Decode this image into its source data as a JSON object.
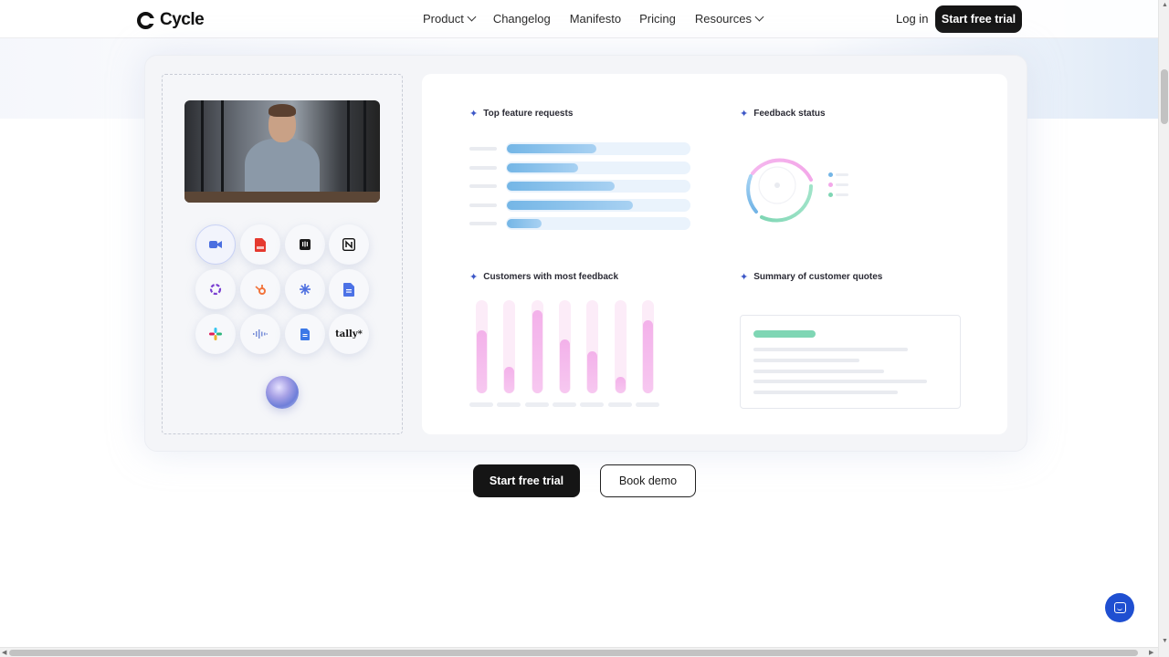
{
  "nav": {
    "logo_text": "Cycle",
    "links": [
      "Product",
      "Changelog",
      "Manifesto",
      "Pricing",
      "Resources"
    ],
    "login": "Log in",
    "cta": "Start free trial"
  },
  "integrations": {
    "icons": [
      "zoom-icon",
      "pdf-icon",
      "intercom-icon",
      "notion-icon",
      "slack-like-icon",
      "hubspot-icon",
      "spark-icon",
      "docs-icon",
      "slack-icon",
      "audio-icon",
      "google-docs-icon",
      "tally-icon"
    ],
    "tally_label": "tally*"
  },
  "panels": {
    "top_feature_requests": "Top feature requests",
    "feedback_status": "Feedback status",
    "customers_most_feedback": "Customers with most feedback",
    "summary_quotes": "Summary of customer quotes"
  },
  "feature_bars": [
    0.49,
    0.39,
    0.59,
    0.69,
    0.19
  ],
  "customer_bars": [
    0.68,
    0.28,
    0.89,
    0.58,
    0.45,
    0.18,
    0.78
  ],
  "actions": {
    "primary": "Start free trial",
    "secondary": "Book demo"
  },
  "colors": {
    "accent": "#3d57c7",
    "bar_blue": "#74b6e6",
    "bar_pink": "#f3b1ea",
    "status_green": "#7fd6b4",
    "chat_blue": "#1f4fd1"
  }
}
